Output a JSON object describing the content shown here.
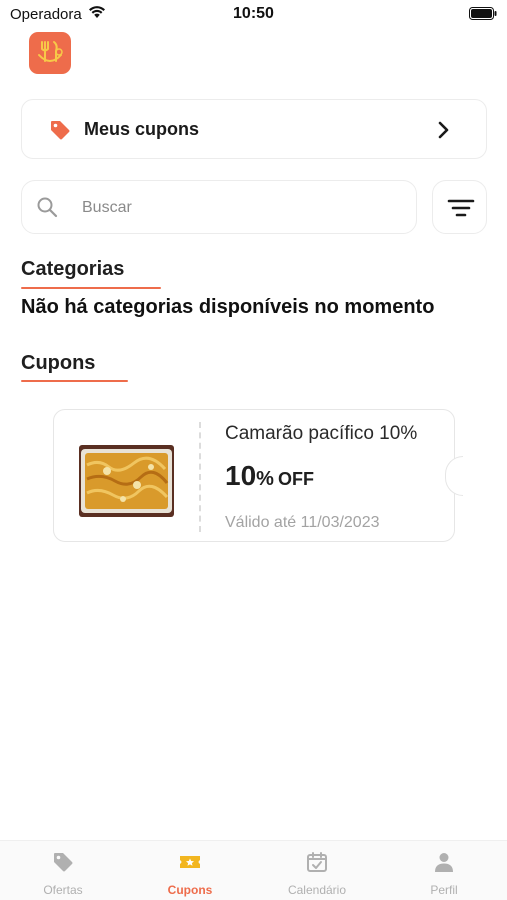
{
  "status_bar": {
    "carrier": "Operadora",
    "time": "10:50",
    "wifi_icon": "wifi-icon",
    "battery_icon": "battery-icon"
  },
  "app": {
    "logo_icon": "restaurant-logo-icon",
    "brand_color": "#ee6c4b"
  },
  "my_coupons": {
    "label": "Meus cupons",
    "icon": "tag-icon"
  },
  "search": {
    "placeholder": "Buscar",
    "value": ""
  },
  "categories": {
    "title": "Categorias",
    "empty_message": "Não há categorias disponíveis no momento"
  },
  "coupons": {
    "title": "Cupons",
    "items": [
      {
        "name": "Camarão pacífico 10%",
        "discount_number": "10",
        "discount_unit": "%",
        "discount_suffix": "OFF",
        "validity": "Válido até 11/03/2023"
      }
    ]
  },
  "tab_bar": {
    "active_color": "#ee6c4b",
    "inactive_color": "#b0b0b0",
    "items": [
      {
        "label": "Ofertas",
        "icon": "tag-icon",
        "active": false
      },
      {
        "label": "Cupons",
        "icon": "coupon-ticket-icon",
        "active": true
      },
      {
        "label": "Calendário",
        "icon": "calendar-icon",
        "active": false
      },
      {
        "label": "Perfil",
        "icon": "person-icon",
        "active": false
      }
    ]
  }
}
